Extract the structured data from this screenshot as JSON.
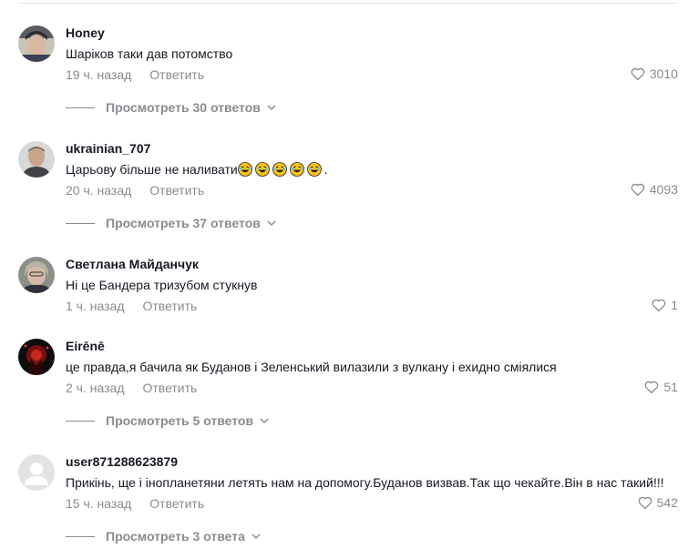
{
  "comments": [
    {
      "username": "Honey",
      "text": "Шаріков таки дав потомство",
      "time": "19 ч. назад",
      "reply_label": "Ответить",
      "likes": "3010",
      "replies_label": "Просмотреть 30 ответов"
    },
    {
      "username": "ukrainian_707",
      "text_before_emoji": "Царьову більше не наливати",
      "emoji": [
        "😂",
        "😂",
        "😂",
        "😂",
        "😂"
      ],
      "text_after_emoji": ".",
      "time": "20 ч. назад",
      "reply_label": "Ответить",
      "likes": "4093",
      "replies_label": "Просмотреть 37 ответов"
    },
    {
      "username": "Светлана Майданчук",
      "text": "Ні це Бандера тризубом стукнув",
      "time": "1 ч. назад",
      "reply_label": "Ответить",
      "likes": "1"
    },
    {
      "username": "Eirēnē",
      "text": "це правда,я бачила як Буданов і Зеленський вилазили з вулкану і ехидно сміялися",
      "time": "2 ч. назад",
      "reply_label": "Ответить",
      "likes": "51",
      "replies_label": "Просмотреть 5 ответов"
    },
    {
      "username": "user871288623879",
      "text": "Прикінь, ще і інопланетяни летять нам на допомогу.Буданов визвав.Так що чекайте.Він в нас такий!!!",
      "time": "15 ч. назад",
      "reply_label": "Ответить",
      "likes": "542",
      "replies_label": "Просмотреть 3 ответа"
    }
  ],
  "icons": {
    "like": "heart-outline-icon",
    "expand": "chevron-down-icon"
  },
  "colors": {
    "text": "#161823",
    "muted": "#8a8b91"
  }
}
